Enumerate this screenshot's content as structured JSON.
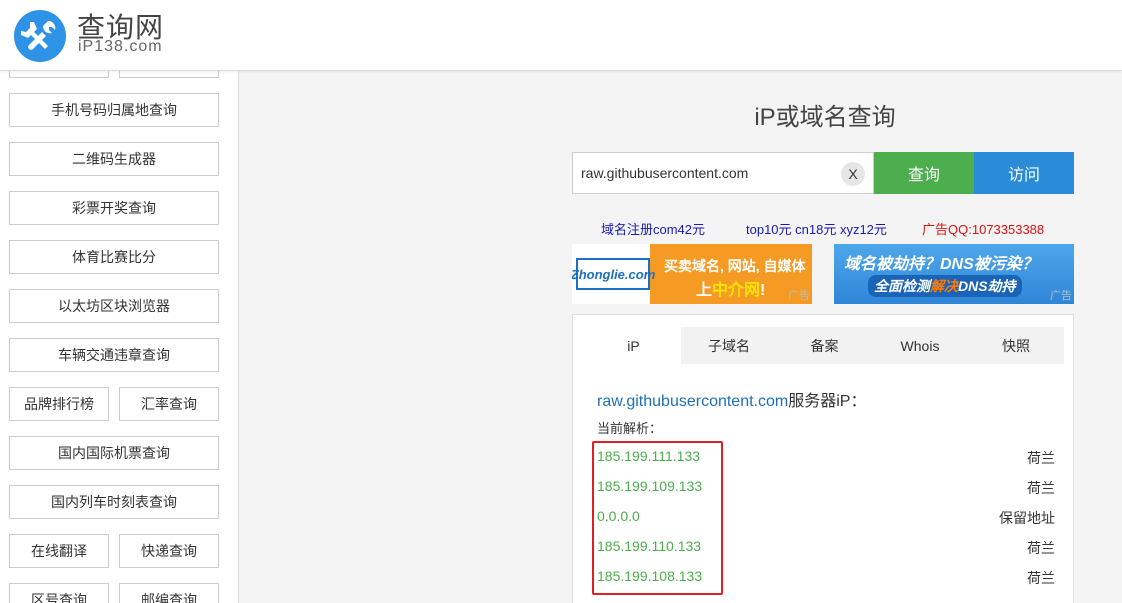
{
  "header": {
    "logo_title": "查询网",
    "logo_sub": "iP138.com"
  },
  "sidebar": {
    "rows": [
      [
        "",
        ""
      ],
      [
        "手机号码归属地查询"
      ],
      [
        "二维码生成器"
      ],
      [
        "彩票开奖查询"
      ],
      [
        "体育比赛比分"
      ],
      [
        "以太坊区块浏览器"
      ],
      [
        "车辆交通违章查询"
      ],
      [
        "品牌排行榜",
        "汇率查询"
      ],
      [
        "国内国际机票查询"
      ],
      [
        "国内列车时刻表查询"
      ],
      [
        "在线翻译",
        "快递查询"
      ],
      [
        "区号查询",
        "邮编查询"
      ]
    ]
  },
  "main": {
    "title": "iP或域名查询",
    "search": {
      "value": "raw.githubusercontent.com",
      "clear_label": "X"
    },
    "query_label": "查询",
    "visit_label": "访问",
    "ad_links": [
      {
        "text": "域名注册com42元",
        "color": "blue"
      },
      {
        "text": "top10元 cn18元 xyz12元",
        "color": "blue"
      },
      {
        "text": "广告QQ:1073353388",
        "color": "red"
      }
    ],
    "banner1": {
      "logo": "Zhonglie.com",
      "line1": "买卖域名, 网站, 自媒体",
      "line2_pre": "上",
      "line2_hl": "中介网",
      "line2_post": "!",
      "tag": "广告"
    },
    "banner2": {
      "line1": "域名被劫持？DNS被污染？",
      "line2_pre": "全面检测",
      "line2_hl": "解决",
      "line2_post": "DNS劫持",
      "tag": "广告"
    }
  },
  "result": {
    "tabs": [
      "iP",
      "子域名",
      "备案",
      "Whois",
      "快照"
    ],
    "active_tab": 0,
    "title_domain": "raw.githubusercontent.com",
    "title_suffix": "服务器iP：",
    "current_label": "当前解析：",
    "records": [
      {
        "ip": "185.199.111.133",
        "location": "荷兰"
      },
      {
        "ip": "185.199.109.133",
        "location": "荷兰"
      },
      {
        "ip": "0.0.0.0",
        "location": "保留地址"
      },
      {
        "ip": "185.199.110.133",
        "location": "荷兰"
      },
      {
        "ip": "185.199.108.133",
        "location": "荷兰"
      }
    ]
  },
  "colors": {
    "accent_green": "#4cae4c",
    "accent_blue": "#2a8bd8",
    "link_blue": "#1e6fb8",
    "highlight_red": "#e02020"
  }
}
